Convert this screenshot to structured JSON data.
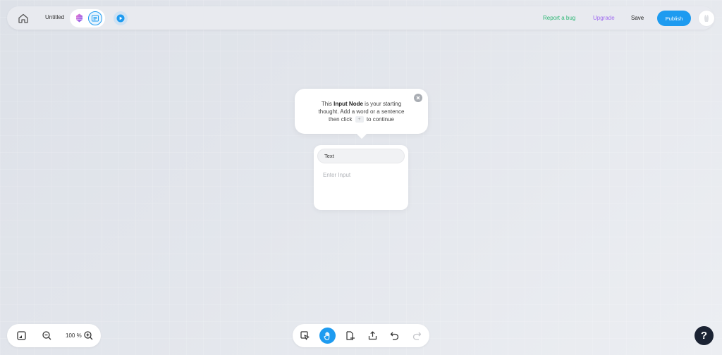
{
  "header": {
    "title": "Untitled",
    "report_bug": "Report a bug",
    "upgrade": "Upgrade",
    "save": "Save",
    "publish": "Publish",
    "icons": {
      "home": "home-icon",
      "mode_a": "gem-icon",
      "mode_b": "document-icon",
      "play": "play-icon",
      "avatar": "user-avatar"
    }
  },
  "tooltip": {
    "text_prefix": "This ",
    "text_bold": "Input Node",
    "text_mid": " is your starting thought. Add a word or a sentence then click ",
    "plus_key": "+",
    "text_suffix": " to continue"
  },
  "node": {
    "type_label": "Text",
    "input_placeholder": "Enter Input",
    "input_value": ""
  },
  "zoom": {
    "level": "100 %"
  },
  "help": {
    "label": "?"
  },
  "colors": {
    "accent": "#1e9bf0",
    "report_link": "#2bb673",
    "upgrade_link": "#a06cf0",
    "help_bg": "#1b2333"
  }
}
